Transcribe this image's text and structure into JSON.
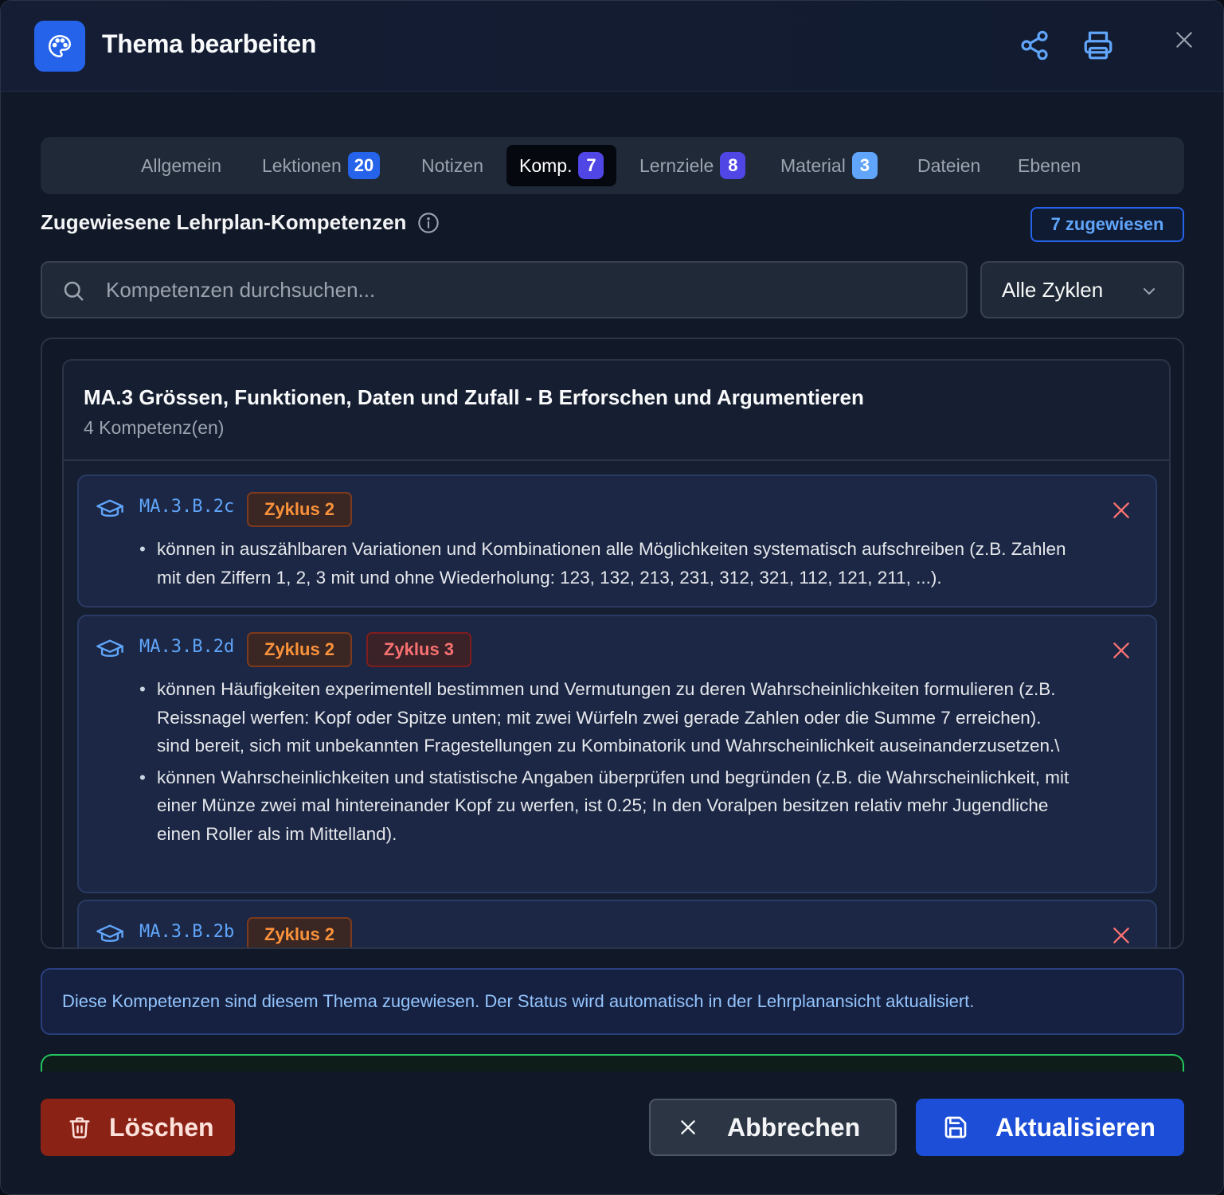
{
  "header": {
    "title": "Thema bearbeiten",
    "icon": "palette-icon"
  },
  "tabs": [
    {
      "label": "Allgemein",
      "badge": null
    },
    {
      "label": "Lektionen",
      "badge": "20"
    },
    {
      "label": "Notizen",
      "badge": null
    },
    {
      "label": "Komp.",
      "badge": "7",
      "active": true
    },
    {
      "label": "Lernziele",
      "badge": "8"
    },
    {
      "label": "Material",
      "badge": "3"
    },
    {
      "label": "Dateien",
      "badge": null
    },
    {
      "label": "Ebenen",
      "badge": null
    }
  ],
  "section": {
    "title": "Zugewiesene Lehrplan-Kompetenzen",
    "assigned_label": "7 zugewiesen"
  },
  "search": {
    "placeholder": "Kompetenzen durchsuchen...",
    "value": ""
  },
  "filter": {
    "selected": "Alle Zyklen"
  },
  "group": {
    "title": "MA.3 Grössen, Funktionen, Daten und Zufall - B Erforschen und Argumentieren",
    "count": "4 Kompetenz(en)",
    "items": [
      {
        "code": "MA.3.B.2c",
        "badges": [
          "Zyklus 2"
        ],
        "bullets": [
          "können in auszählbaren Variationen und Kombinationen alle Möglichkeiten systematisch aufschreiben (z.B. Zahlen mit den Ziffern 1, 2, 3 mit und ohne Wiederholung: 123, 132, 213, 231, 312, 321, 112, 121, 211, ...)."
        ]
      },
      {
        "code": "MA.3.B.2d",
        "badges": [
          "Zyklus 2",
          "Zyklus 3"
        ],
        "bullets": [
          "können Häufigkeiten experimentell bestimmen und Vermutungen zu deren Wahrscheinlichkeiten formulieren (z.B. Reissnagel werfen: Kopf oder Spitze unten; mit zwei Würfeln zwei gerade Zahlen oder die Summe 7 erreichen). sind bereit, sich mit unbekannten Fragestellungen zu Kombinatorik und Wahrscheinlichkeit auseinanderzusetzen.\\",
          "können Wahrscheinlichkeiten und statistische Angaben überprüfen und begründen (z.B. die Wahrscheinlichkeit, mit einer Münze zwei mal hintereinander Kopf zu werfen, ist 0.25; In den Voralpen besitzen relativ mehr Jugendliche einen Roller als im Mittelland)."
        ]
      },
      {
        "code": "MA.3.B.2b",
        "badges": [
          "Zyklus 2"
        ],
        "bullets": []
      }
    ]
  },
  "info_text": "Diese Kompetenzen sind diesem Thema zugewiesen. Der Status wird automatisch in der Lehrplanansicht aktualisiert.",
  "footer": {
    "delete_label": "Löschen",
    "cancel_label": "Abbrechen",
    "update_label": "Aktualisieren"
  },
  "colors": {
    "accent": "#2563eb",
    "danger": "#8b2216",
    "zyklus2": "#fb923c",
    "zyklus3": "#f87171"
  }
}
